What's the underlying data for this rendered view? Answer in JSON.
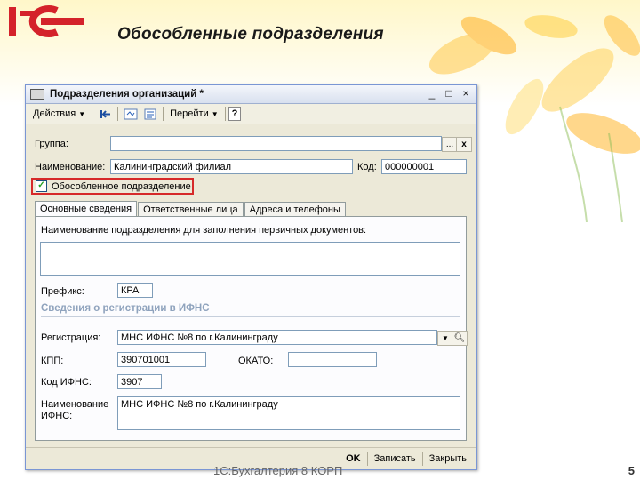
{
  "slide": {
    "title": "Обособленные подразделения",
    "footer": "1С:Бухгалтерия 8 КОРП",
    "page_number": "5",
    "logo_text": "1С"
  },
  "window": {
    "title": "Подразделения организаций *",
    "controls": [
      "_",
      "□",
      "×"
    ],
    "toolbar": {
      "actions_label": "Действия",
      "goto_label": "Перейти",
      "help_label": "?"
    },
    "form": {
      "group_label": "Группа:",
      "group_value": "",
      "name_label": "Наименование:",
      "name_value": "Калининградский филиал",
      "code_label": "Код:",
      "code_value": "000000001",
      "separate_checkbox_label": "Обособленное подразделение",
      "separate_checked": true
    },
    "tabs": [
      "Основные сведения",
      "Ответственные лица",
      "Адреса и телефоны"
    ],
    "active_tab": 0,
    "main": {
      "primary_docs_label": "Наименование подразделения для заполнения первичных документов:",
      "primary_docs_value": "",
      "prefix_label": "Префикс:",
      "prefix_value": "КРА",
      "section_title": "Сведения о регистрации в ИФНС",
      "registration_label": "Регистрация:",
      "registration_value": "МНС ИФНС №8 по г.Калининграду",
      "kpp_label": "КПП:",
      "kpp_value": "390701001",
      "okato_label": "ОКАТО:",
      "okato_value": "",
      "ifns_code_label": "Код ИФНС:",
      "ifns_code_value": "3907",
      "ifns_name_label_1": "Наименование",
      "ifns_name_label_2": "ИФНС:",
      "ifns_name_value": "МНС ИФНС №8 по г.Калининграду"
    },
    "buttons": {
      "ok": "OK",
      "save": "Записать",
      "close": "Закрыть"
    }
  },
  "colors": {
    "highlight_border": "#d62a2a",
    "logo_red": "#d4222a",
    "title_bar": "#d8e0ef"
  },
  "icons": [
    "app-window-icon",
    "back-arrow-icon",
    "refresh-icon",
    "list-icon",
    "help-icon",
    "ellipsis-icon",
    "clear-icon",
    "dropdown-icon",
    "search-icon",
    "flower-decoration"
  ]
}
